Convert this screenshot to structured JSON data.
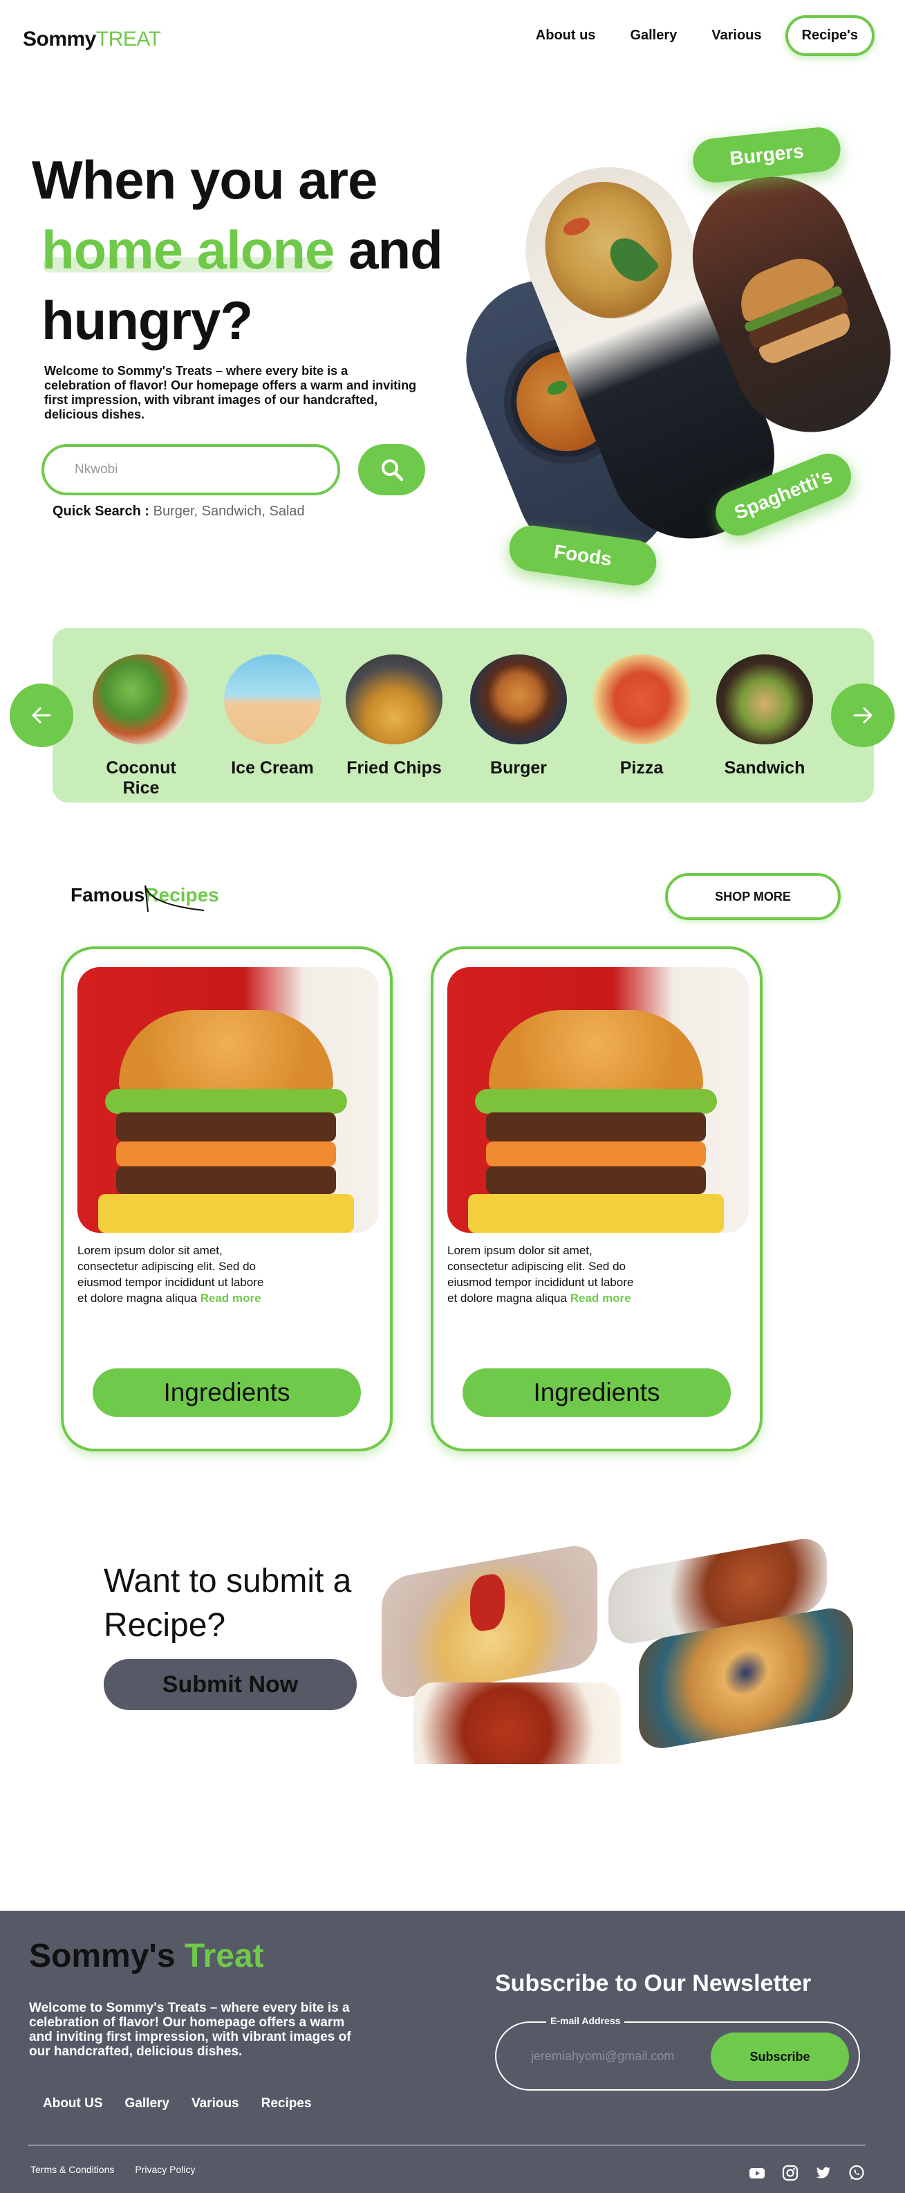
{
  "header": {
    "logo_part1": "Sommy",
    "logo_part2": "TREAT",
    "nav": [
      "About us",
      "Gallery",
      "Various",
      "Recipe's"
    ]
  },
  "hero": {
    "line1": "When you are",
    "line2_green": "home alone",
    "line2_rest": " and",
    "line3": "hungry?",
    "description": "Welcome to Sommy's Treats – where every bite is a celebration of flavor! Our homepage offers a warm and inviting first impression, with vibrant images of our handcrafted, delicious dishes.",
    "search_placeholder": "Nkwobi",
    "quick_label": "Quick Search :",
    "quick_items": "Burger, Sandwich, Salad",
    "tags": {
      "burgers": "Burgers",
      "spaghettis": "Spaghetti's",
      "foods": "Foods"
    }
  },
  "categories": [
    {
      "label": "Coconut Rice"
    },
    {
      "label": "Ice Cream"
    },
    {
      "label": "Fried Chips"
    },
    {
      "label": "Burger"
    },
    {
      "label": "Pizza"
    },
    {
      "label": "Sandwich"
    }
  ],
  "famous": {
    "title_part1": "Famous",
    "title_part2": "Recipes",
    "shop_more": "SHOP MORE",
    "cards": [
      {
        "text": "Lorem ipsum dolor sit amet, consectetur adipiscing elit. Sed do eiusmod tempor incididunt ut labore et dolore magna aliqua",
        "read_more": "Read more",
        "button": "Ingredients"
      },
      {
        "text": "Lorem ipsum dolor sit amet, consectetur adipiscing elit. Sed do eiusmod tempor incididunt ut labore et dolore magna aliqua",
        "read_more": "Read more",
        "button": "Ingredients"
      }
    ]
  },
  "submit": {
    "title": "Want to submit a Recipe?",
    "button": "Submit Now"
  },
  "footer": {
    "logo_part1": "Sommy's",
    "logo_part2": " Treat",
    "description": "Welcome to Sommy's Treats – where every bite is a celebration of flavor! Our homepage offers a warm and inviting first impression, with vibrant images of our handcrafted, delicious dishes.",
    "links": [
      "About US",
      "Gallery",
      "Various",
      "Recipes"
    ],
    "newsletter_title": "Subscribe to  Our Newsletter",
    "email_label": "E-mail Address",
    "email_placeholder": "jeremiahyomi@gmail.com",
    "subscribe": "Subscribe",
    "legal": [
      "Terms & Conditions",
      "Privacy Policy"
    ],
    "social_icons": [
      "youtube-icon",
      "instagram-icon",
      "twitter-icon",
      "whatsapp-icon"
    ]
  },
  "colors": {
    "accent": "#6fc94a",
    "band": "#c8edb8",
    "footer_bg": "#565a66"
  }
}
